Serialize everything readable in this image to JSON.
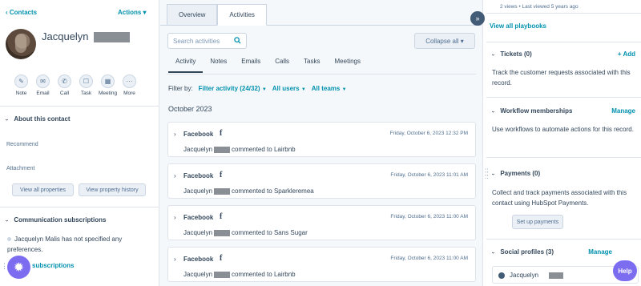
{
  "left": {
    "back_link": "‹ Contacts",
    "actions": "Actions ▾",
    "contact_first_name": "Jacquelyn",
    "quick_actions": [
      {
        "label": "Note",
        "icon": "note-icon"
      },
      {
        "label": "Email",
        "icon": "email-icon"
      },
      {
        "label": "Call",
        "icon": "call-icon"
      },
      {
        "label": "Task",
        "icon": "task-icon"
      },
      {
        "label": "Meeting",
        "icon": "meeting-icon"
      },
      {
        "label": "More",
        "icon": "more-icon"
      }
    ],
    "about_title": "About this contact",
    "prop_recommend": "Recommend",
    "prop_attachment": "Attachment",
    "view_all_properties": "View all properties",
    "view_property_history": "View property history",
    "comm_title": "Communication subscriptions",
    "comm_text": "Jacquelyn Malis has not specified any preferences.",
    "manage_subs": "subscriptions"
  },
  "center": {
    "tabs": [
      {
        "label": "Overview"
      },
      {
        "label": "Activities"
      }
    ],
    "search_placeholder": "Search activities",
    "collapse_all": "Collapse all ▾",
    "sub_tabs": [
      "Activity",
      "Notes",
      "Emails",
      "Calls",
      "Tasks",
      "Meetings"
    ],
    "filter_by": "Filter by:",
    "filter_activity": "Filter activity (24/32)",
    "all_users": "All users",
    "all_teams": "All teams",
    "month": "October 2023",
    "activities": [
      {
        "source": "Facebook",
        "date": "Friday, October 6, 2023 12:32 PM",
        "name": "Jacquelyn",
        "action": "commented to Lairbnb"
      },
      {
        "source": "Facebook",
        "date": "Friday, October 6, 2023 11:01 AM",
        "name": "Jacquelyn",
        "action": "commented to Sparkleremea"
      },
      {
        "source": "Facebook",
        "date": "Friday, October 6, 2023 11:00 AM",
        "name": "Jacquelyn",
        "action": "commented to Sans Sugar"
      },
      {
        "source": "Facebook",
        "date": "Friday, October 6, 2023 11:00 AM",
        "name": "Jacquelyn",
        "action": "commented to Lairbnb"
      }
    ]
  },
  "right": {
    "views_text": "2 views • Last viewed 5 years ago",
    "view_all_playbooks": "View all playbooks",
    "tickets_title": "Tickets (0)",
    "tickets_add": "+ Add",
    "tickets_text": "Track the customer requests associated with this record.",
    "workflow_title": "Workflow memberships",
    "workflow_manage": "Manage",
    "workflow_text": "Use workflows to automate actions for this record.",
    "payments_title": "Payments (0)",
    "payments_text": "Collect and track payments associated with this contact using HubSpot Payments.",
    "setup_payments": "Set up payments",
    "social_title": "Social profiles (3)",
    "social_manage": "Manage",
    "social_name": "Jacquelyn",
    "help": "Help"
  },
  "colors": {
    "accent": "#0091ae",
    "text": "#33475b",
    "fab": "#7c6cf0"
  }
}
